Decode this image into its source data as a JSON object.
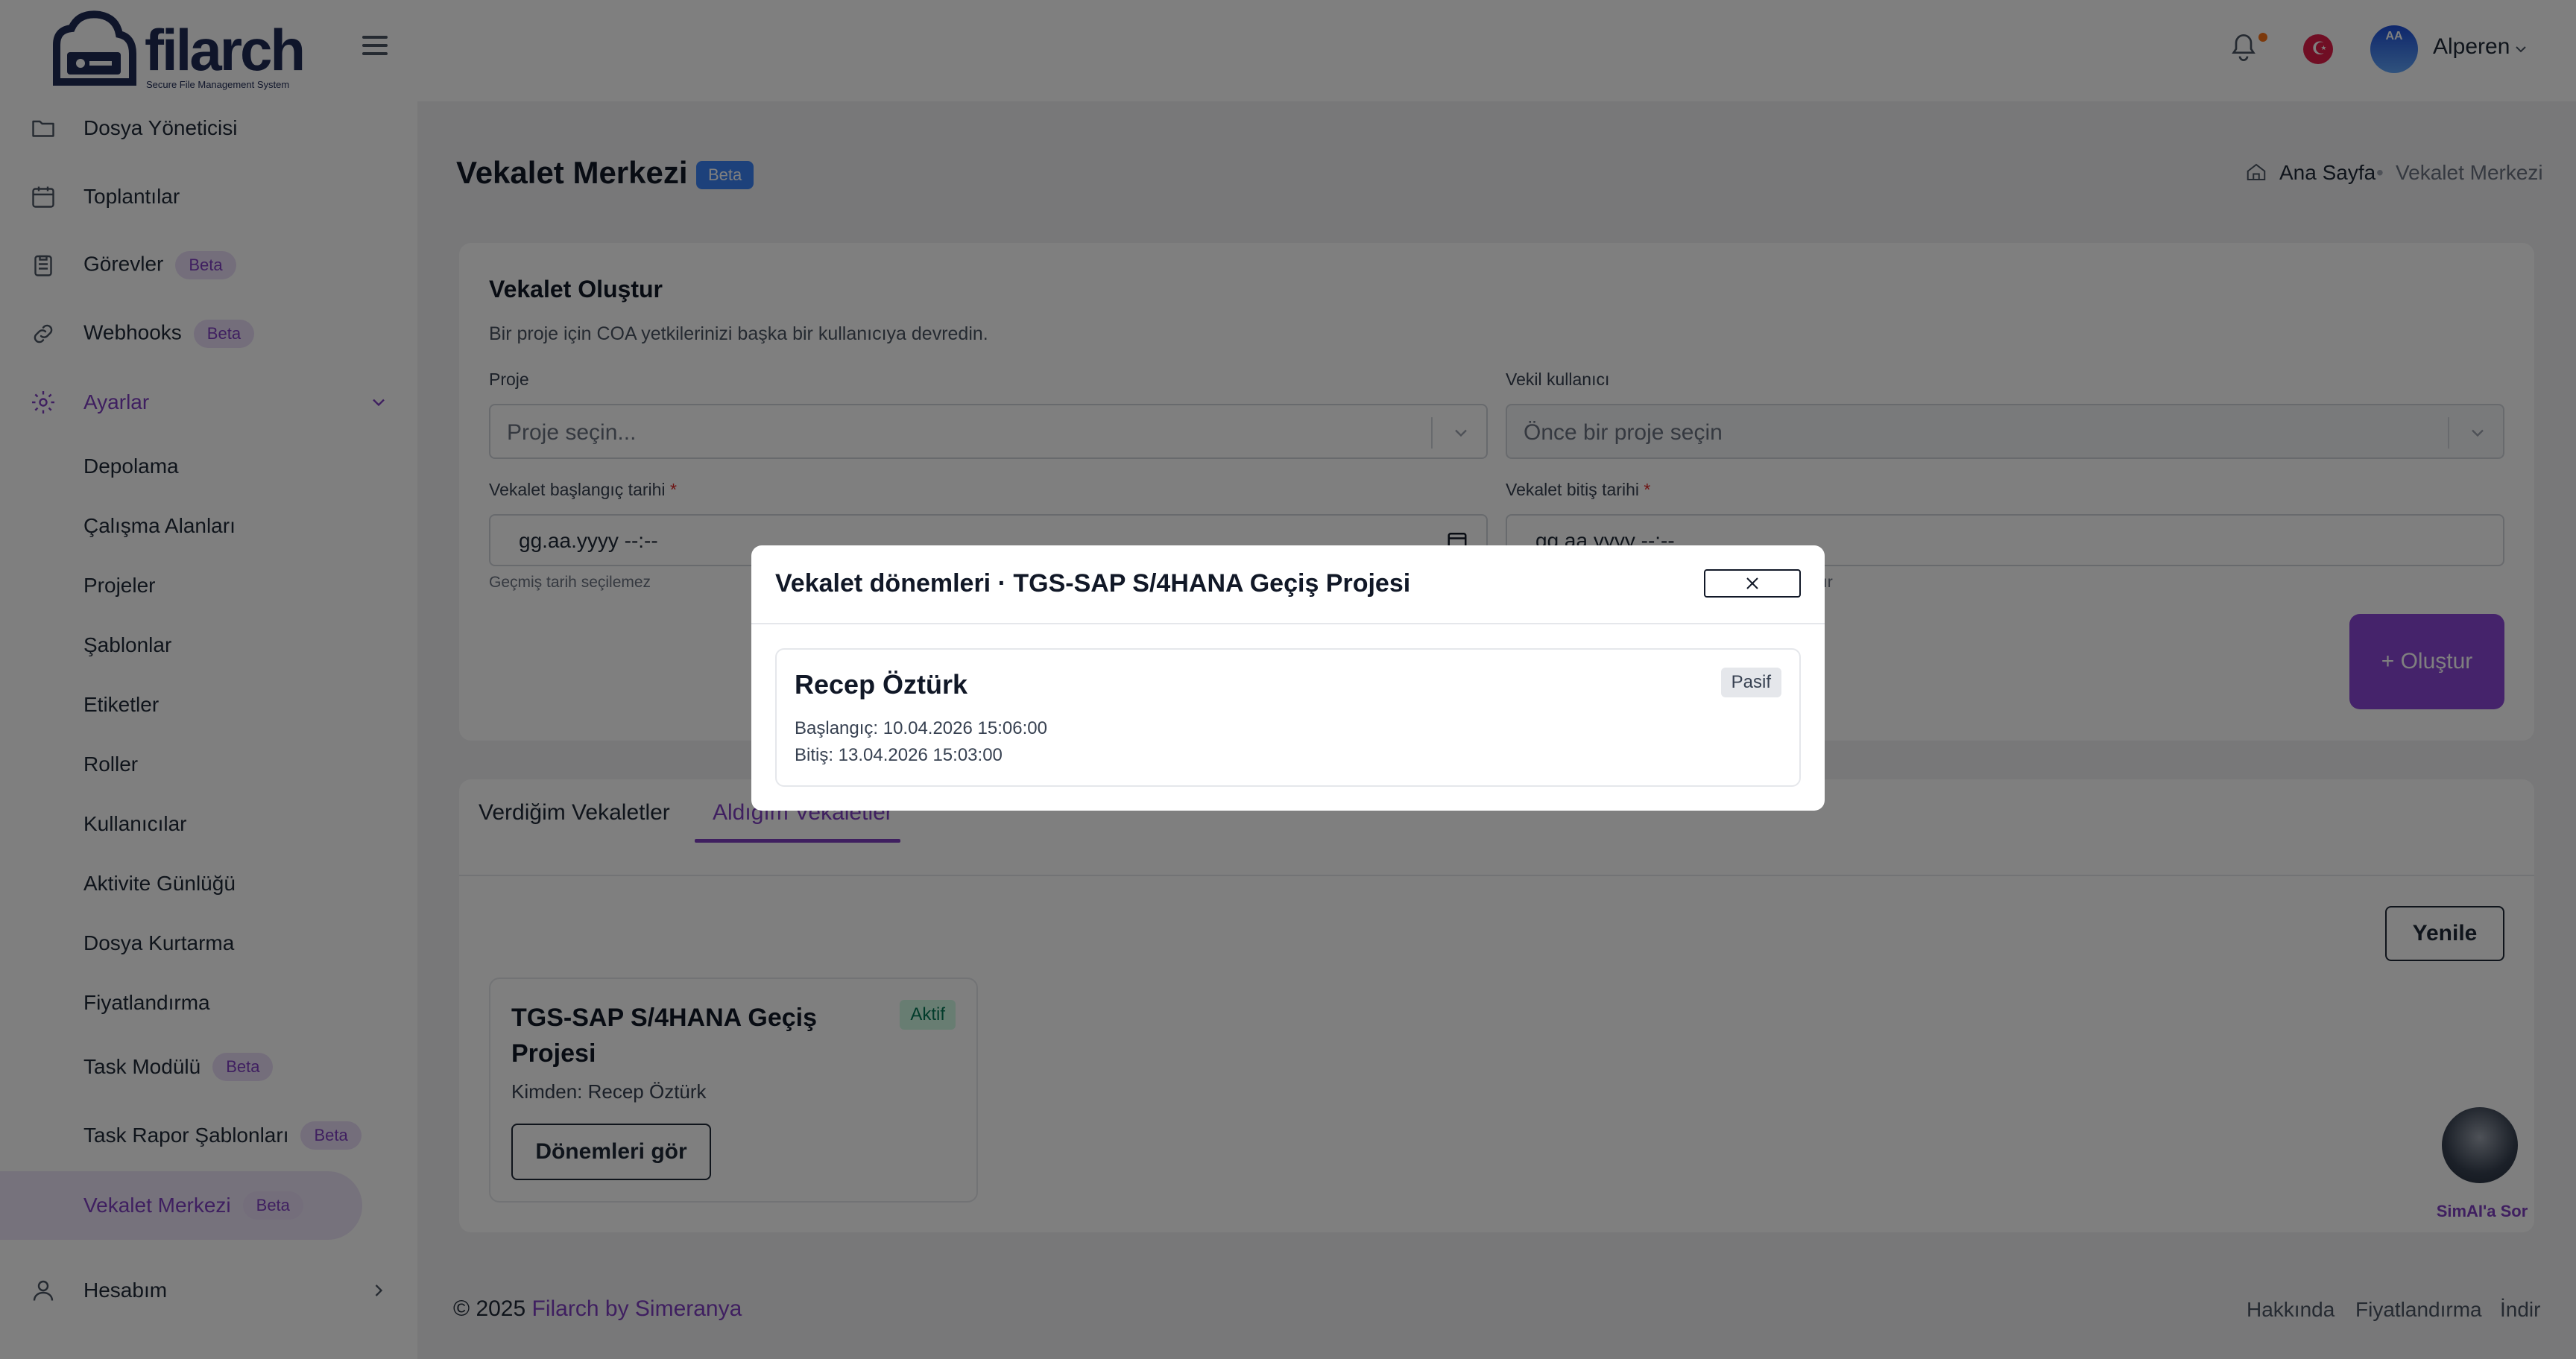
{
  "app": {
    "logo_text": "filarch",
    "logo_subtitle": "Secure File Management System"
  },
  "sidebar": {
    "items": [
      {
        "label": "Dosya Yöneticisi",
        "icon": "folder-icon"
      },
      {
        "label": "Toplantılar",
        "icon": "calendar-icon"
      },
      {
        "label": "Görevler",
        "icon": "clipboard-icon",
        "badge": "Beta"
      },
      {
        "label": "Webhooks",
        "icon": "link-icon",
        "badge": "Beta"
      },
      {
        "label": "Ayarlar",
        "icon": "gear-icon",
        "expanded": true
      }
    ],
    "settings_sub": [
      {
        "label": "Depolama"
      },
      {
        "label": "Çalışma Alanları"
      },
      {
        "label": "Projeler"
      },
      {
        "label": "Şablonlar"
      },
      {
        "label": "Etiketler"
      },
      {
        "label": "Roller"
      },
      {
        "label": "Kullanıcılar"
      },
      {
        "label": "Aktivite Günlüğü"
      },
      {
        "label": "Dosya Kurtarma"
      },
      {
        "label": "Fiyatlandırma"
      },
      {
        "label": "Task Modülü",
        "badge": "Beta"
      },
      {
        "label": "Task Rapor Şablonları",
        "badge": "Beta"
      },
      {
        "label": "Vekalet Merkezi",
        "badge": "Beta",
        "active": true
      }
    ],
    "account": {
      "label": "Hesabım",
      "icon": "user-icon"
    }
  },
  "header": {
    "user_initials": "AA",
    "user_name": "Alperen"
  },
  "page": {
    "title": "Vekalet Merkezi",
    "title_badge": "Beta",
    "breadcrumb_home": "Ana Sayfa",
    "breadcrumb_sep": "•",
    "breadcrumb_current": "Vekalet Merkezi"
  },
  "create_form": {
    "title": "Vekalet Oluştur",
    "subtitle": "Bir proje için COA yetkilerinizi başka bir kullanıcıya devredin.",
    "project_label": "Proje",
    "project_placeholder": "Proje seçin...",
    "proxy_label": "Vekil kullanıcı",
    "proxy_placeholder": "Önce bir proje seçin",
    "start_label": "Vekalet başlangıç tarihi",
    "start_value": "gg.aa.yyyy --:--",
    "start_help": "Geçmiş tarih seçilemez",
    "end_label": "Vekalet bitiş tarihi",
    "end_value": "gg.aa.yyyy --:--",
    "end_help": "alıdır",
    "required_mark": "*",
    "create_button": "+ Oluştur"
  },
  "tabs": {
    "given": "Verdiğim Vekaletler",
    "received": "Aldığım Vekaletler",
    "active_tab": "received"
  },
  "received_list": {
    "refresh_button": "Yenile",
    "cards": [
      {
        "project": "TGS-SAP S/4HANA Geçiş Projesi",
        "status": "Aktif",
        "from": "Kimden: Recep Öztürk",
        "periods_button": "Dönemleri gör"
      }
    ]
  },
  "assistant": {
    "label": "SimAI'a Sor"
  },
  "footer": {
    "copyright": "© 2025",
    "brand": "Filarch by Simeranya",
    "links": [
      "Hakkında",
      "Fiyatlandırma",
      "İndir"
    ]
  },
  "modal": {
    "title": "Vekalet dönemleri · TGS-SAP S/4HANA Geçiş Projesi",
    "periods": [
      {
        "name": "Recep Öztürk",
        "status": "Pasif",
        "start": "Başlangıç: 10.04.2026 15:06:00",
        "end": "Bitiş: 13.04.2026 15:03:00"
      }
    ]
  },
  "colors": {
    "accent": "#7e3fc1",
    "primary_button": "#8b47d6",
    "beta_blue": "#3b82f6",
    "status_active": "#047857"
  }
}
